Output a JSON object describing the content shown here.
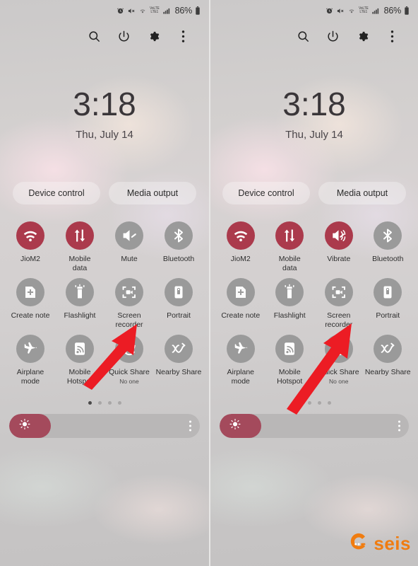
{
  "statusbar": {
    "alarm_icon": "alarm-icon",
    "mute_icon": "mute-icon",
    "wifi_icon": "wifi-icon",
    "volte_line1": "VoLTE",
    "volte_line2": "LTE1",
    "signal_icon": "signal-bars-icon",
    "battery_percent": "86%",
    "battery_icon": "battery-icon"
  },
  "header": {
    "search_icon": "search-icon",
    "power_icon": "power-icon",
    "settings_icon": "gear-icon",
    "more_icon": "more-vertical-icon"
  },
  "clock": {
    "time": "3:18",
    "date": "Thu, July 14"
  },
  "pills": {
    "device_control": "Device control",
    "media_output": "Media output"
  },
  "colors": {
    "active": "#ab3a4c",
    "inactive": "#9a9a9a",
    "brightness_fill": "#a44a5c",
    "arrow": "#ec1c24",
    "watermark": "#f07c10"
  },
  "left_panel": {
    "tiles": [
      {
        "label": "JioM2",
        "icon": "wifi-icon",
        "state": "on",
        "sub": ""
      },
      {
        "label": "Mobile\ndata",
        "icon": "mobile-data-icon",
        "state": "on",
        "sub": ""
      },
      {
        "label": "Mute",
        "icon": "mute-speaker-icon",
        "state": "off",
        "sub": ""
      },
      {
        "label": "Bluetooth",
        "icon": "bluetooth-icon",
        "state": "off",
        "sub": ""
      },
      {
        "label": "Create note",
        "icon": "create-note-icon",
        "state": "off",
        "sub": ""
      },
      {
        "label": "Flashlight",
        "icon": "flashlight-icon",
        "state": "off",
        "sub": ""
      },
      {
        "label": "Screen\nrecorder",
        "icon": "screen-recorder-icon",
        "state": "off",
        "sub": ""
      },
      {
        "label": "Portrait",
        "icon": "rotation-lock-icon",
        "state": "off",
        "sub": ""
      },
      {
        "label": "Airplane\nmode",
        "icon": "airplane-icon",
        "state": "off",
        "sub": ""
      },
      {
        "label": "Mobile\nHotspot",
        "icon": "hotspot-icon",
        "state": "off",
        "sub": ""
      },
      {
        "label": "Quick Share",
        "icon": "quick-share-icon",
        "state": "off",
        "sub": "No one"
      },
      {
        "label": "Nearby Share",
        "icon": "nearby-share-icon",
        "state": "off",
        "sub": ""
      }
    ]
  },
  "right_panel": {
    "tiles": [
      {
        "label": "JioM2",
        "icon": "wifi-icon",
        "state": "on",
        "sub": ""
      },
      {
        "label": "Mobile\ndata",
        "icon": "mobile-data-icon",
        "state": "on",
        "sub": ""
      },
      {
        "label": "Vibrate",
        "icon": "vibrate-icon",
        "state": "on",
        "sub": ""
      },
      {
        "label": "Bluetooth",
        "icon": "bluetooth-icon",
        "state": "off",
        "sub": ""
      },
      {
        "label": "Create note",
        "icon": "create-note-icon",
        "state": "off",
        "sub": ""
      },
      {
        "label": "Flashlight",
        "icon": "flashlight-icon",
        "state": "off",
        "sub": ""
      },
      {
        "label": "Screen\nrecorder",
        "icon": "screen-recorder-icon",
        "state": "off",
        "sub": ""
      },
      {
        "label": "Portrait",
        "icon": "rotation-lock-icon",
        "state": "off",
        "sub": ""
      },
      {
        "label": "Airplane\nmode",
        "icon": "airplane-icon",
        "state": "off",
        "sub": ""
      },
      {
        "label": "Mobile\nHotspot",
        "icon": "hotspot-icon",
        "state": "off",
        "sub": ""
      },
      {
        "label": "Quick Share",
        "icon": "quick-share-icon",
        "state": "off",
        "sub": "No one"
      },
      {
        "label": "Nearby Share",
        "icon": "nearby-share-icon",
        "state": "off",
        "sub": ""
      }
    ]
  },
  "pager": {
    "count": 4,
    "active_index": 0
  },
  "brightness": {
    "percent": 22,
    "sun_icon": "brightness-sun-icon",
    "menu_icon": "more-vertical-icon"
  },
  "annotations": {
    "left_arrow_target": "Mute",
    "right_arrow_target": "Vibrate"
  },
  "watermark": {
    "text": "seis",
    "logo_icon": "seis-logo-icon"
  }
}
